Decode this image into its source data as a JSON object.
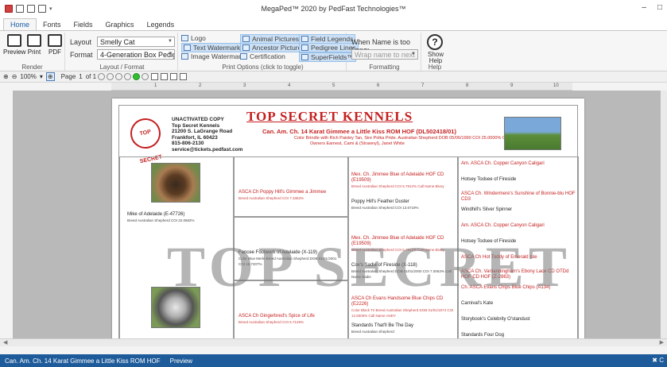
{
  "app": {
    "title": "MegaPed™ 2020 by PedFast Technologies™",
    "window_controls": [
      "–",
      "□"
    ]
  },
  "tabs": [
    {
      "label": "Home",
      "active": true
    },
    {
      "label": "Fonts"
    },
    {
      "label": "Fields"
    },
    {
      "label": "Graphics"
    },
    {
      "label": "Legends"
    }
  ],
  "ribbon": {
    "render": {
      "label": "Render",
      "preview": "Preview",
      "print": "Print",
      "pdf": "PDF"
    },
    "layout_format": {
      "label": "Layout / Format",
      "layout_label": "Layout",
      "layout_value": "Smelly Cat",
      "format_label": "Format",
      "format_value": "4-Generation Box Pedigree,"
    },
    "print_options": {
      "label": "Print Options (click to toggle)",
      "logo": "Logo",
      "text_watermark": "Text Watermark",
      "image_watermark": "Image Watermark",
      "animal_pictures": "Animal Pictures",
      "ancestor_pictures": "Ancestor Pictures",
      "certification": "Certification",
      "field_legends": "Field Legends",
      "pedigree_lines": "Pedigree Lines",
      "superfields": "SuperFields™"
    },
    "formatting": {
      "label": "Formatting",
      "name_too_long": "When Name is too Long:",
      "wrap_value": "Wrap name to next line"
    },
    "help": {
      "label": "Help",
      "show_help": "Show Help"
    }
  },
  "toolbar": {
    "zoom": "100%",
    "page_label": "Page",
    "page_value": "1",
    "of_label": "of 1"
  },
  "ruler_numbers": [
    "1",
    "2",
    "3",
    "4",
    "5",
    "6",
    "7",
    "8",
    "9",
    "10"
  ],
  "document": {
    "title": "TOP SECRET KENNELS",
    "stamp": "TOP SECRET",
    "kennel_lines": [
      "UNACTIVATED COPY",
      "Top Secret Kennels",
      "21200 S. LaGrange Road",
      "Frankfort, IL 60423",
      "815-806-2130",
      "service@tickets.pedfast.com"
    ],
    "subject_name": "Can. Am. Ch. 14 Karat Gimmee a Little Kiss ROM HOF (DL502418/01)",
    "subject_detail": "Color Brindle with Rich Paisley Tan, Sire Polka Pride. Australian Shepherd DOB 05/06/1990 COI 25.0000% Call Name Kissy",
    "subject_owners": "Owners Earnest, Cami & (Strawnyl), Janet White",
    "watermark": "TOP SECRET",
    "gen1": [
      {
        "name": "Mike of Adelaide (E-47726)",
        "detail": "Breed Australian Shepherd COI 22.0682%"
      }
    ],
    "gen2": [
      {
        "name": "ASCA Ch Poppy Hill's Gimmee a Jimmee",
        "detail": "Breed Australian Shepherd COI 7.3363%",
        "red": true
      },
      {
        "name": "Fancee Footwork of Adelaide (X-119)",
        "detail": "Color Blue Merle Breed Australian Shepherd DOB 01/01/2001 COI 15.7207%",
        "red": false
      },
      {
        "name": "ASCA Ch Gingerbred's Spice of Life",
        "detail": "Breed Australian Shepherd COI 5.7129%",
        "red": true
      }
    ],
    "gen3": [
      {
        "name": "Mex. Ch. Jimmee Blue of Adelaide HOF CD (E19509)",
        "detail": "Breed Australian Shepherd COI 5.7912% Call Name Blusy",
        "red": true
      },
      {
        "name": "Poppy Hill's Feather Duster",
        "detail": "Breed Australian Shepherd COI 13.6719%",
        "red": false
      },
      {
        "name": "Mex. Ch. Jimmee Blue of Adelaide HOF CD (E19509)",
        "detail": "Breed Australian Shepherd COI 5.7912% Call Name Blusy",
        "red": true
      },
      {
        "name": "Cox's Sadie of Fireside (X-118)",
        "detail": "Breed Australian Shepherd DOB 01/01/2000 COI 7.0063% Call Name Sadie",
        "red": false
      },
      {
        "name": "ASCA Ch Evans Handsome Blue Chips CD (E2226)",
        "detail": "Color Black Tri Breed Australian Shepherd DOB 01/01/1974 COI 12.5000% Call Name ANDY",
        "red": true
      },
      {
        "name": "Standards That'll Be The Day",
        "detail": "Breed Australian Shepherd",
        "red": false
      }
    ],
    "gen4": [
      {
        "name": "Am. ASCA Ch. Copper Canyon Caligari",
        "red": true
      },
      {
        "name": "Hotsey Todsee of Fireside",
        "red": false
      },
      {
        "name": "ASCA Ch. Windermere's Sunshine of Bonnie-blu HOF CD3",
        "red": true
      },
      {
        "name": "Windhill's Silver Spinner",
        "red": false
      },
      {
        "name": "Am. ASCA Ch. Copper Canyon Caligari",
        "red": true
      },
      {
        "name": "Hotsey Todsee of Fireside",
        "red": false
      },
      {
        "name": "ASCA Ch Hot Toddy of Emerald Isle",
        "red": true
      },
      {
        "name": "ASCA Ch. Vanlandingham's Ebony Lace CD OTDd HOF CD HOF (Z-2863)",
        "red": true
      },
      {
        "name": "Ch. ASCA Evans Chips Blue Chips (A134)",
        "red": true
      },
      {
        "name": "Carnival's Kate",
        "red": false
      },
      {
        "name": "Storybook's Celebrity O'standust",
        "red": false
      },
      {
        "name": "Standards Four Dog",
        "red": false
      }
    ]
  },
  "status": {
    "left": "Can. Am. Ch. 14 Karat Gimmee a Little Kiss ROM HOF",
    "mode": "Preview",
    "right": "✖ C"
  }
}
